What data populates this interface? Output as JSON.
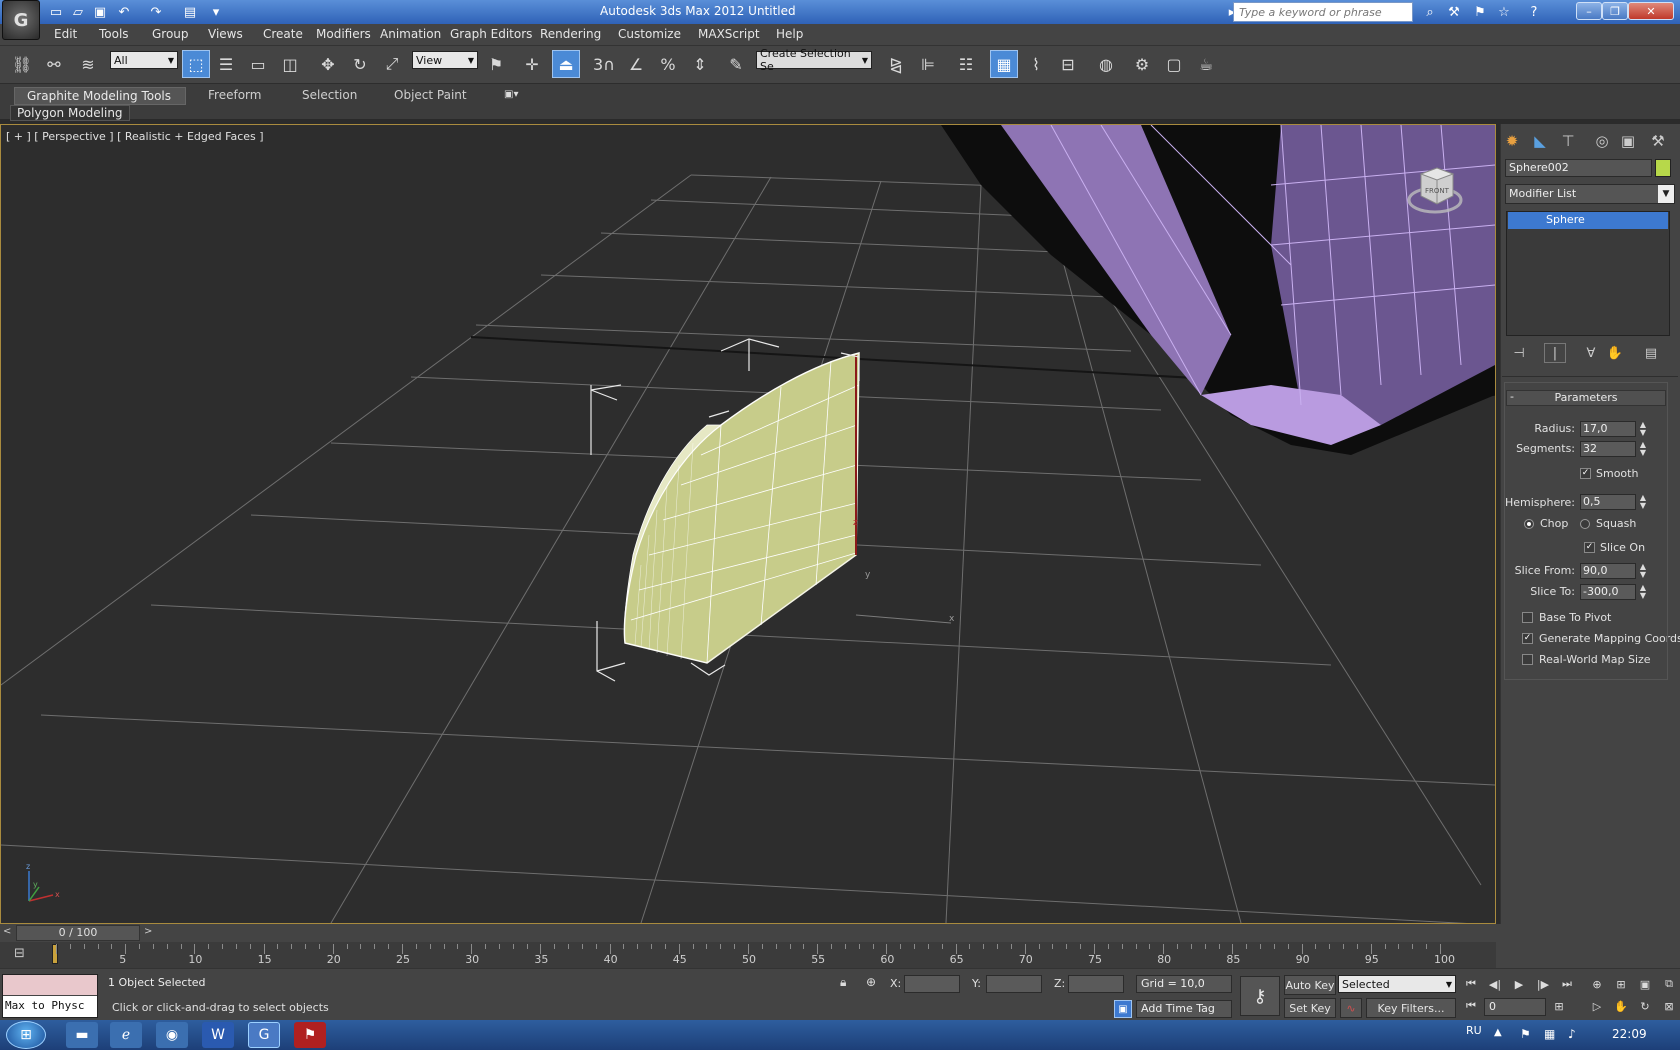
{
  "titlebar": {
    "app_logo": "G",
    "title": "Autodesk 3ds Max  2012     Untitled",
    "search_placeholder": "Type a keyword or phrase"
  },
  "menu": [
    "Edit",
    "Tools",
    "Group",
    "Views",
    "Create",
    "Modifiers",
    "Animation",
    "Graph Editors",
    "Rendering",
    "Customize",
    "MAXScript",
    "Help"
  ],
  "toolbar": {
    "selection_filter": "All",
    "reference_coord": "View",
    "named_selection": "Create Selection Se",
    "snap_3": "3"
  },
  "ribbon": {
    "tabs": [
      "Graphite Modeling Tools",
      "Freeform",
      "Selection",
      "Object Paint"
    ],
    "panel": "Polygon Modeling"
  },
  "viewport": {
    "label": "[ + ] [ Perspective ] [ Realistic + Edged Faces ]",
    "viewcube_face": "FRONT",
    "axis_x": "x",
    "axis_y": "y",
    "axis_z": "z"
  },
  "command_panel": {
    "object_name": "Sphere002",
    "object_color": "#b7d84a",
    "modifier_list": "Modifier List",
    "stack_item": "Sphere",
    "params_title": "Parameters",
    "params_collapse": "-",
    "radius_label": "Radius:",
    "radius_value": "17,0",
    "segments_label": "Segments:",
    "segments_value": "32",
    "smooth_label": "Smooth",
    "hemisphere_label": "Hemisphere:",
    "hemisphere_value": "0,5",
    "chop_label": "Chop",
    "squash_label": "Squash",
    "slice_on_label": "Slice On",
    "slice_from_label": "Slice From:",
    "slice_from_value": "90,0",
    "slice_to_label": "Slice To:",
    "slice_to_value": "-300,0",
    "base_to_pivot_label": "Base To Pivot",
    "gen_mapping_label": "Generate Mapping Coords",
    "real_world_label": "Real-World Map Size"
  },
  "timeline": {
    "frame_display": "0 / 100",
    "ticks": [
      "5",
      "10",
      "15",
      "20",
      "25",
      "30",
      "35",
      "40",
      "45",
      "50",
      "55",
      "60",
      "65",
      "70",
      "75",
      "80",
      "85",
      "90",
      "95",
      "100"
    ]
  },
  "status": {
    "maxscript_text": "Max to Physc",
    "selected_count": "1 Object Selected",
    "prompt": "Click or click-and-drag to select objects",
    "x_label": "X:",
    "y_label": "Y:",
    "z_label": "Z:",
    "grid": "Grid = 10,0",
    "add_time_tag": "Add Time Tag",
    "auto_key": "Auto Key",
    "set_key": "Set Key",
    "selected_option": "Selected",
    "key_filters": "Key Filters...",
    "current_frame": "0"
  },
  "taskbar": {
    "lang": "RU",
    "time": "22:09"
  },
  "colors": {
    "accent": "#4b8ad6",
    "viewport_border": "#a98b3e",
    "selection_blue": "#3d79d0",
    "object_yellow": "#c7cc8a",
    "purple_object": "#b99be0"
  }
}
